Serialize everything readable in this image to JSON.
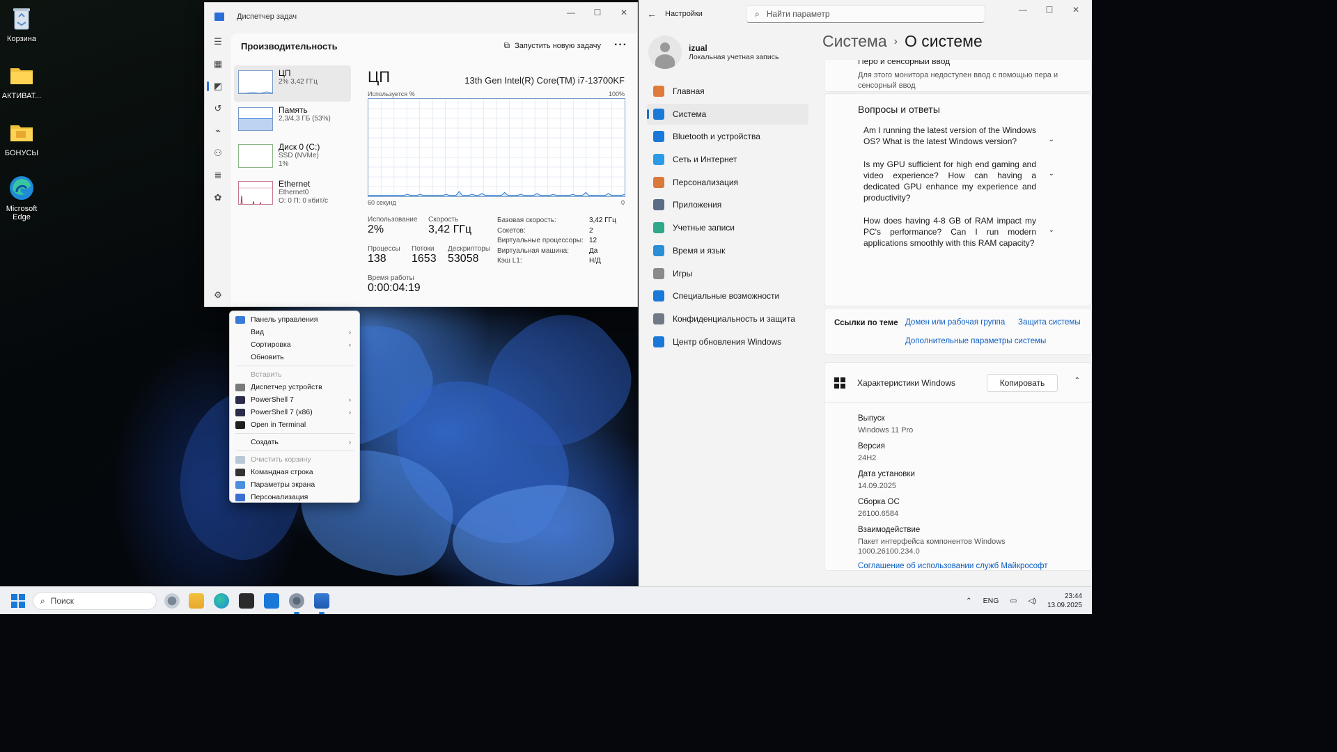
{
  "desktop": {
    "icons": [
      {
        "label": "Корзина"
      },
      {
        "label": "АКТИВАТ..."
      },
      {
        "label": "БОНУСЫ"
      },
      {
        "label": "Microsoft Edge"
      }
    ]
  },
  "task_manager": {
    "window_title": "Диспетчер задач",
    "section_title": "Производительность",
    "new_task_label": "Запустить новую задачу",
    "more_label": "···",
    "perf_items": [
      {
        "name": "ЦП",
        "line2": "2% 3,42 ГГц",
        "line3": ""
      },
      {
        "name": "Память",
        "line2": "2,3/4,3 ГБ (53%)",
        "line3": ""
      },
      {
        "name": "Диск 0 (C:)",
        "line2": "SSD (NVMe)",
        "line3": "1%"
      },
      {
        "name": "Ethernet",
        "line2": "Ethernet0",
        "line3": "О: 0 П: 0 кбит/с"
      }
    ],
    "cpu": {
      "title": "ЦП",
      "model": "13th Gen Intel(R) Core(TM) i7-13700KF",
      "graph_top_left": "Используется %",
      "graph_top_right": "100%",
      "graph_bottom_left": "60 секунд",
      "graph_bottom_right": "0",
      "usage_label": "Использование",
      "usage_value": "2%",
      "speed_label": "Скорость",
      "speed_value": "3,42 ГГц",
      "processes_label": "Процессы",
      "processes_value": "138",
      "threads_label": "Потоки",
      "threads_value": "1653",
      "handles_label": "Дескрипторы",
      "handles_value": "53058",
      "uptime_label": "Время работы",
      "uptime_value": "0:00:04:19",
      "details": [
        {
          "k": "Базовая скорость:",
          "v": "3,42 ГГц"
        },
        {
          "k": "Сокетов:",
          "v": "2"
        },
        {
          "k": "Виртуальные процессоры:",
          "v": "12"
        },
        {
          "k": "Виртуальная машина:",
          "v": "Да"
        },
        {
          "k": "Кэш L1:",
          "v": "Н/Д"
        }
      ],
      "graph_points": [
        1,
        1,
        1,
        1,
        1,
        1,
        1,
        1,
        1,
        1,
        1,
        1,
        2,
        1,
        1,
        1,
        2,
        1,
        1,
        1,
        1,
        1,
        1,
        1,
        2,
        1,
        1,
        1,
        5,
        1,
        1,
        1,
        2,
        1,
        1,
        3,
        1,
        1,
        1,
        1,
        1,
        1,
        4,
        1,
        1,
        1,
        1,
        2,
        1,
        1,
        1,
        1,
        3,
        1,
        1,
        1,
        1,
        2,
        1,
        1,
        1,
        1,
        1,
        2,
        1,
        1,
        1,
        4,
        1,
        1,
        1,
        1,
        1,
        1,
        3,
        1,
        1,
        1,
        1,
        2
      ]
    }
  },
  "context_menu": {
    "items": [
      {
        "label": "Панель управления",
        "icon_color": "#3a7bd5",
        "submenu": false,
        "disabled": false
      },
      {
        "label": "Вид",
        "icon_color": "",
        "submenu": true,
        "disabled": false
      },
      {
        "label": "Сортировка",
        "icon_color": "",
        "submenu": true,
        "disabled": false
      },
      {
        "label": "Обновить",
        "icon_color": "",
        "submenu": false,
        "disabled": false
      },
      {
        "sep": true
      },
      {
        "label": "Вставить",
        "icon_color": "",
        "submenu": false,
        "disabled": true
      },
      {
        "label": "Диспетчер устройств",
        "icon_color": "#7a7a7a",
        "submenu": false,
        "disabled": false
      },
      {
        "label": "PowerShell 7",
        "icon_color": "#2b2b4a",
        "submenu": true,
        "disabled": false
      },
      {
        "label": "PowerShell 7 (x86)",
        "icon_color": "#2b2b4a",
        "submenu": true,
        "disabled": false
      },
      {
        "label": "Open in Terminal",
        "icon_color": "#1f1f1f",
        "submenu": false,
        "disabled": false
      },
      {
        "sep": true
      },
      {
        "label": "Создать",
        "icon_color": "",
        "submenu": true,
        "disabled": false
      },
      {
        "sep": true
      },
      {
        "label": "Очистить корзину",
        "icon_color": "#b9c7d6",
        "submenu": false,
        "disabled": true
      },
      {
        "label": "Командная строка",
        "icon_color": "#333333",
        "submenu": false,
        "disabled": false
      },
      {
        "label": "Параметры экрана",
        "icon_color": "#4a8fe0",
        "submenu": false,
        "disabled": false
      },
      {
        "label": "Персонализация",
        "icon_color": "#3b6fd0",
        "submenu": false,
        "disabled": false
      }
    ]
  },
  "settings": {
    "window_title": "Настройки",
    "search_placeholder": "Найти параметр",
    "user_name": "izual",
    "user_subtitle": "Локальная учетная запись",
    "nav": [
      {
        "label": "Главная",
        "color": "#e07a3a"
      },
      {
        "label": "Система",
        "color": "#1a78d8"
      },
      {
        "label": "Bluetooth и устройства",
        "color": "#1a78d8"
      },
      {
        "label": "Сеть и Интернет",
        "color": "#2b9be6"
      },
      {
        "label": "Персонализация",
        "color": "#d9793a"
      },
      {
        "label": "Приложения",
        "color": "#5a6b86"
      },
      {
        "label": "Учетные записи",
        "color": "#2fa88a"
      },
      {
        "label": "Время и язык",
        "color": "#2b8fd6"
      },
      {
        "label": "Игры",
        "color": "#8a8a8a"
      },
      {
        "label": "Специальные возможности",
        "color": "#1a78d8"
      },
      {
        "label": "Конфиденциальность и защита",
        "color": "#6f7a86"
      },
      {
        "label": "Центр обновления Windows",
        "color": "#1a78d8"
      }
    ],
    "breadcrumb_parent": "Система",
    "breadcrumb_sep": "›",
    "breadcrumb_current": "О системе",
    "pen_title": "Перо и сенсорный ввод",
    "pen_desc": "Для этого монитора недоступен ввод с помощью пера и сенсорный ввод",
    "faq_title": "Вопросы и ответы",
    "faq": [
      "Am I running the latest version of the Windows OS? What is the latest Windows version?",
      "Is my GPU sufficient for high end gaming and video experience? How can having a dedicated GPU enhance my experience and productivity?",
      "How does having 4-8 GB of RAM impact my PC's performance? Can I run modern applications smoothly with this RAM capacity?"
    ],
    "related_label": "Ссылки по теме",
    "related_links": [
      "Домен или рабочая группа",
      "Защита системы",
      "Дополнительные параметры системы"
    ],
    "spec_title": "Характеристики Windows",
    "copy_label": "Копировать",
    "specs": [
      {
        "k": "Выпуск",
        "v": "Windows 11 Pro"
      },
      {
        "k": "Версия",
        "v": "24H2"
      },
      {
        "k": "Дата установки",
        "v": "14.09.2025"
      },
      {
        "k": "Сборка ОС",
        "v": "26100.6584"
      },
      {
        "k": "Взаимодействие",
        "v": "Пакет интерфейса компонентов Windows 1000.26100.234.0"
      }
    ],
    "ms_link": "Соглашение об использовании служб Майкрософт"
  },
  "taskbar": {
    "search_placeholder": "Поиск",
    "lang": "ENG",
    "time": "23:44",
    "date": "13.09.2025"
  }
}
